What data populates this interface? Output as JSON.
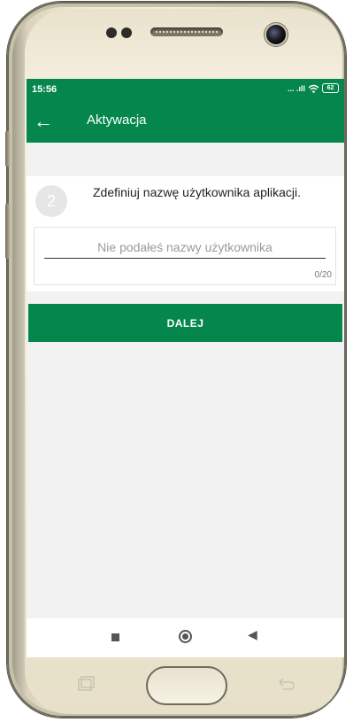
{
  "status_bar": {
    "time": "15:56",
    "signal_text": "... .ıll",
    "battery": "62"
  },
  "app_bar": {
    "back_icon": "arrow-left-icon",
    "title": "Aktywacja"
  },
  "step": {
    "number": "2",
    "instruction": "Zdefiniuj nazwę użytkownika aplikacji."
  },
  "username_field": {
    "value": "",
    "placeholder": "Nie podałeś nazwy użytkownika",
    "counter": "0/20"
  },
  "next_button": {
    "label": "DALEJ"
  },
  "colors": {
    "brand": "#05864d",
    "background": "#f2f2f2"
  },
  "nav_bar": {
    "icons": [
      "recents-square-icon",
      "home-circle-icon",
      "back-triangle-icon"
    ]
  }
}
